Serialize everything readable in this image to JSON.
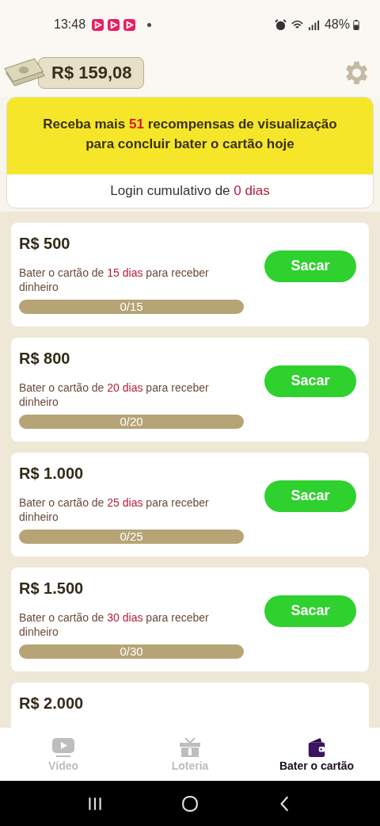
{
  "status_bar": {
    "time": "13:48",
    "battery": "48%"
  },
  "balance": {
    "amount": "R$ 159,08"
  },
  "banner": {
    "before": "Receba mais ",
    "highlight": "51",
    "after": " recompensas de visualização para concluir bater o cartão hoje"
  },
  "login": {
    "before": "Login cumulativo de ",
    "highlight": "0 dias"
  },
  "rewards": [
    {
      "amount": "R$ 500",
      "desc_before": "Bater o cartão de ",
      "desc_highlight": "15 dias",
      "desc_after": " para receber dinheiro",
      "progress": "0/15",
      "level": 0,
      "button": "Sacar"
    },
    {
      "amount": "R$ 800",
      "desc_before": "Bater o cartão de ",
      "desc_highlight": "20 dias",
      "desc_after": " para receber dinheiro",
      "progress": "0/20",
      "level": 0,
      "button": "Sacar"
    },
    {
      "amount": "R$ 1.000",
      "desc_before": "Bater o cartão de ",
      "desc_highlight": "25 dias",
      "desc_after": " para receber dinheiro",
      "progress": "0/25",
      "level": 0,
      "button": "Sacar"
    },
    {
      "amount": "R$ 1.500",
      "desc_before": "Bater o cartão de ",
      "desc_highlight": "30 dias",
      "desc_after": " para receber dinheiro",
      "progress": "0/30",
      "level": 0,
      "button": "Sacar"
    },
    {
      "amount": "R$ 2.000"
    }
  ],
  "nav": [
    {
      "label": "Vídeo",
      "kind": "video",
      "selected": false
    },
    {
      "label": "Loteria",
      "kind": "gift",
      "selected": false
    },
    {
      "label": "Bater o cartão",
      "kind": "wallet",
      "selected": true
    }
  ]
}
